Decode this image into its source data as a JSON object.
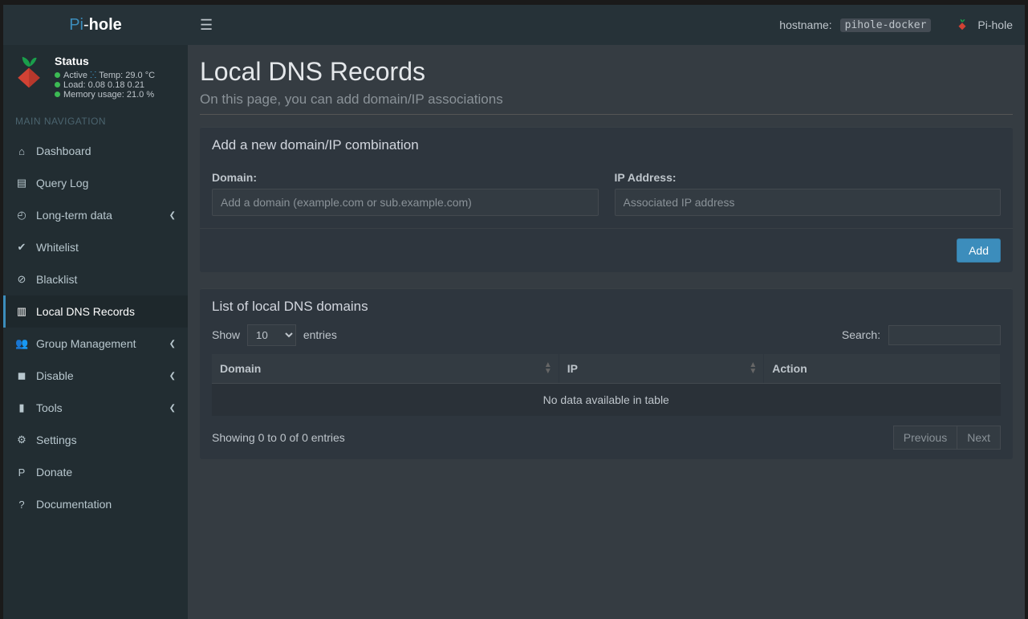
{
  "logo": {
    "pi": "Pi",
    "sep": "-",
    "hole": "hole"
  },
  "status": {
    "title": "Status",
    "active": "Active",
    "temp_label": "Temp:",
    "temp_value": "29.0 °C",
    "load_label": "Load:",
    "load_value": "0.08 0.18 0.21",
    "mem_label": "Memory usage:",
    "mem_value": "21.0 %"
  },
  "nav_header": "MAIN NAVIGATION",
  "nav": {
    "dashboard": "Dashboard",
    "querylog": "Query Log",
    "longterm": "Long-term data",
    "whitelist": "Whitelist",
    "blacklist": "Blacklist",
    "localdns": "Local DNS Records",
    "group": "Group Management",
    "disable": "Disable",
    "tools": "Tools",
    "settings": "Settings",
    "donate": "Donate",
    "docs": "Documentation"
  },
  "topbar": {
    "hostname_label": "hostname:",
    "hostname_value": "pihole-docker",
    "brand": "Pi-hole"
  },
  "page": {
    "title": "Local DNS Records",
    "subtitle": "On this page, you can add domain/IP associations"
  },
  "add_box": {
    "title": "Add a new domain/IP combination",
    "domain_label": "Domain:",
    "domain_placeholder": "Add a domain (example.com or sub.example.com)",
    "ip_label": "IP Address:",
    "ip_placeholder": "Associated IP address",
    "add_button": "Add"
  },
  "list_box": {
    "title": "List of local DNS domains",
    "show": "Show",
    "entries": "entries",
    "page_size_selected": "10",
    "search_label": "Search:",
    "col_domain": "Domain",
    "col_ip": "IP",
    "col_action": "Action",
    "empty": "No data available in table",
    "info": "Showing 0 to 0 of 0 entries",
    "prev": "Previous",
    "next": "Next"
  }
}
